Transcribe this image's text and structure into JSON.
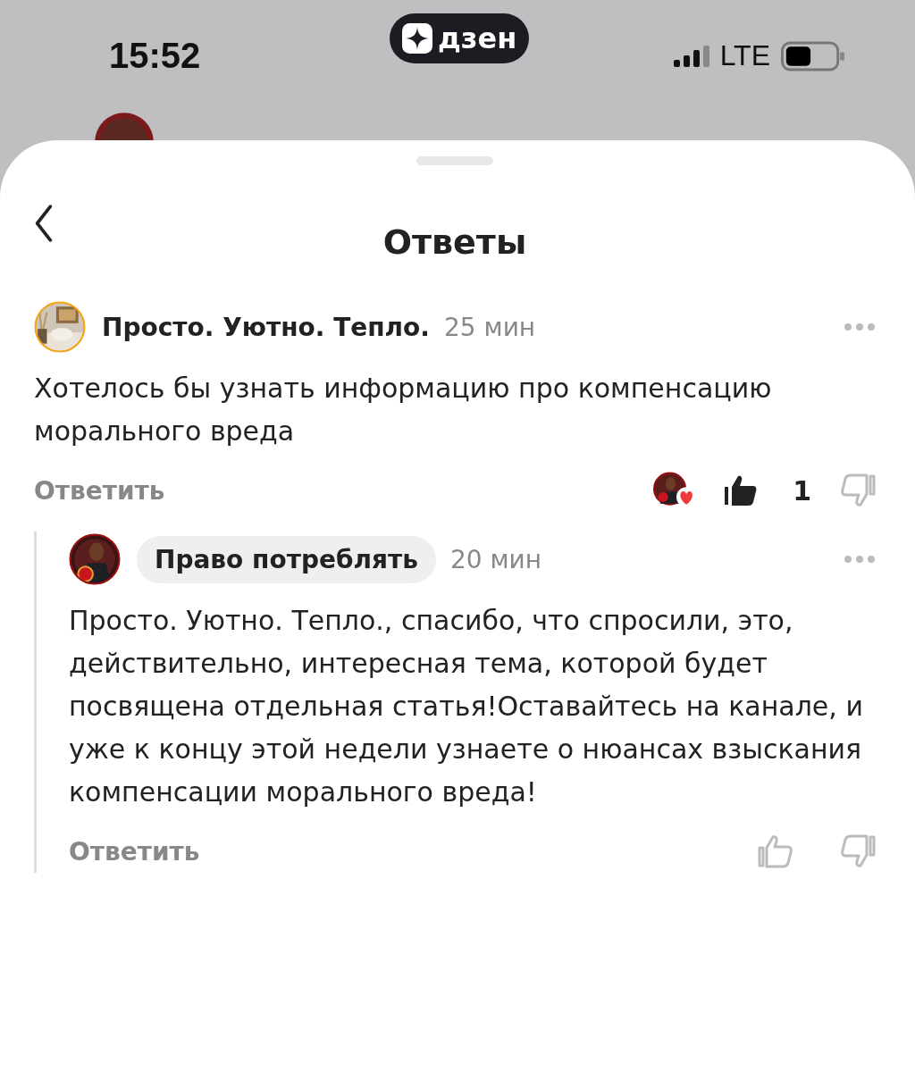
{
  "status_bar": {
    "time": "15:52",
    "app_badge": "дзен",
    "network": "LTE"
  },
  "header": {
    "title": "Ответы"
  },
  "comments": [
    {
      "author": "Просто. Уютно. Тепло.",
      "author_highlighted": false,
      "time": "25 мин",
      "text": "Хотелось бы узнать информацию про компенсацию морального вреда",
      "reply_label": "Ответить",
      "liked": true,
      "liked_by_author": true,
      "likes": "1",
      "nested": false
    },
    {
      "author": "Право потреблять",
      "author_highlighted": true,
      "time": "20 мин",
      "text": "Просто. Уютно. Тепло., спасибо, что спросили, это, действительно, интересная тема, которой будет посвящена отдельная статья!Оставайтесь на канале, и уже к концу этой недели узнаете о нюансах взыскания компенсации морального вреда!",
      "reply_label": "Ответить",
      "liked": false,
      "liked_by_author": false,
      "nested": true
    }
  ]
}
